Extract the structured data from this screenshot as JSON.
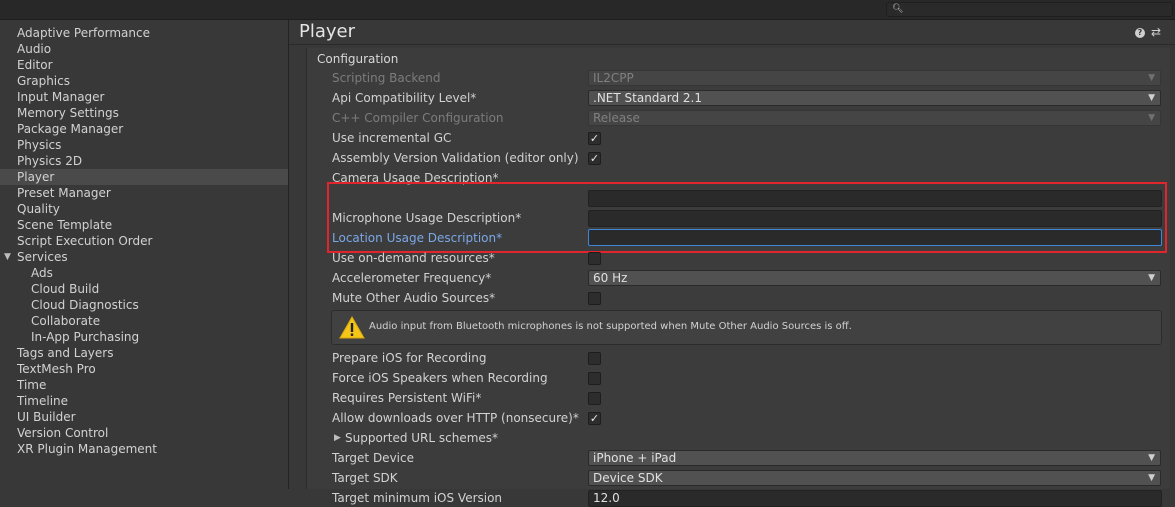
{
  "search": {
    "placeholder": ""
  },
  "sidebar": {
    "items": [
      {
        "label": "Adaptive Performance"
      },
      {
        "label": "Audio"
      },
      {
        "label": "Editor"
      },
      {
        "label": "Graphics"
      },
      {
        "label": "Input Manager"
      },
      {
        "label": "Memory Settings"
      },
      {
        "label": "Package Manager"
      },
      {
        "label": "Physics"
      },
      {
        "label": "Physics 2D"
      },
      {
        "label": "Player",
        "selected": true
      },
      {
        "label": "Preset Manager"
      },
      {
        "label": "Quality"
      },
      {
        "label": "Scene Template"
      },
      {
        "label": "Script Execution Order"
      },
      {
        "label": "Services",
        "expanded": true
      },
      {
        "label": "Ads",
        "child": true
      },
      {
        "label": "Cloud Build",
        "child": true
      },
      {
        "label": "Cloud Diagnostics",
        "child": true
      },
      {
        "label": "Collaborate",
        "child": true
      },
      {
        "label": "In-App Purchasing",
        "child": true
      },
      {
        "label": "Tags and Layers"
      },
      {
        "label": "TextMesh Pro"
      },
      {
        "label": "Time"
      },
      {
        "label": "Timeline"
      },
      {
        "label": "UI Builder"
      },
      {
        "label": "Version Control"
      },
      {
        "label": "XR Plugin Management"
      }
    ]
  },
  "main": {
    "title": "Player",
    "help_icon": "?",
    "settings_icon": "⇄",
    "section_title": "Configuration",
    "settings": {
      "scripting_backend": {
        "label": "Scripting Backend",
        "value": "IL2CPP"
      },
      "api_compat": {
        "label": "Api Compatibility Level*",
        "value": ".NET Standard 2.1"
      },
      "cpp_compiler": {
        "label": "C++ Compiler Configuration",
        "value": "Release"
      },
      "incremental_gc": {
        "label": "Use incremental GC",
        "checked": true
      },
      "assembly_validation": {
        "label": "Assembly Version Validation (editor only)",
        "checked": true
      },
      "camera_usage": {
        "label": "Camera Usage Description*",
        "value": ""
      },
      "microphone_usage": {
        "label": "Microphone Usage Description*",
        "value": ""
      },
      "location_usage": {
        "label": "Location Usage Description*",
        "value": ""
      },
      "on_demand": {
        "label": "Use on-demand resources*",
        "checked": false
      },
      "accelerometer": {
        "label": "Accelerometer Frequency*",
        "value": "60 Hz"
      },
      "mute_audio": {
        "label": "Mute Other Audio Sources*",
        "checked": false
      },
      "warning": "Audio input from Bluetooth microphones is not supported when Mute Other Audio Sources is off.",
      "prepare_ios": {
        "label": "Prepare iOS for Recording",
        "checked": false
      },
      "force_speakers": {
        "label": "Force iOS Speakers when Recording",
        "checked": false
      },
      "persistent_wifi": {
        "label": "Requires Persistent WiFi*",
        "checked": false
      },
      "allow_http": {
        "label": "Allow downloads over HTTP (nonsecure)*",
        "checked": true
      },
      "url_schemes": {
        "label": "Supported URL schemes*"
      },
      "target_device": {
        "label": "Target Device",
        "value": "iPhone + iPad"
      },
      "target_sdk": {
        "label": "Target SDK",
        "value": "Device SDK"
      },
      "min_ios": {
        "label": "Target minimum iOS Version",
        "value": "12.0"
      }
    }
  },
  "glyphs": {
    "check": "✓",
    "caret": "▼",
    "arrow_right": "▶",
    "arrow_down": "▼",
    "warning": "!"
  },
  "colors": {
    "highlight": "#e0262c",
    "focus": "#3d87d8",
    "warning": "#f5c518"
  }
}
